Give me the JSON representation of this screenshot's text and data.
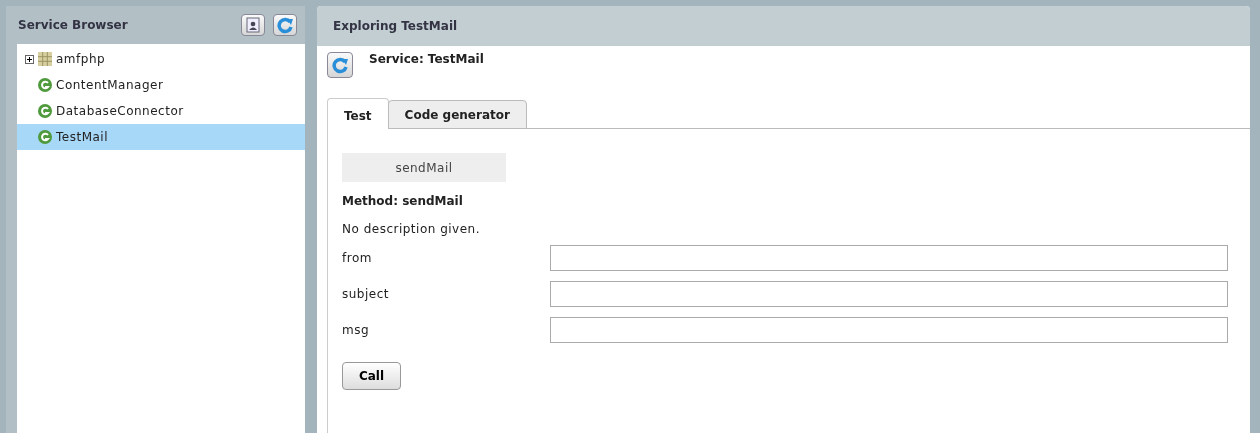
{
  "sidebar": {
    "title": "Service Browser",
    "tree": [
      {
        "label": "amfphp",
        "kind": "package",
        "expanded": false,
        "selected": false
      },
      {
        "label": "ContentManager",
        "kind": "service",
        "selected": false
      },
      {
        "label": "DatabaseConnector",
        "kind": "service",
        "selected": false
      },
      {
        "label": "TestMail",
        "kind": "service",
        "selected": true
      }
    ]
  },
  "main": {
    "title": "Exploring TestMail",
    "service_title": "Service: TestMail",
    "tabs": [
      {
        "label": "Test",
        "selected": true
      },
      {
        "label": "Code generator",
        "selected": false
      }
    ],
    "methods": [
      "sendMail"
    ],
    "method_title": "Method: sendMail",
    "description": "No description given.",
    "params": [
      {
        "label": "from"
      },
      {
        "label": "subject"
      },
      {
        "label": "msg"
      }
    ],
    "call_button": "Call"
  }
}
